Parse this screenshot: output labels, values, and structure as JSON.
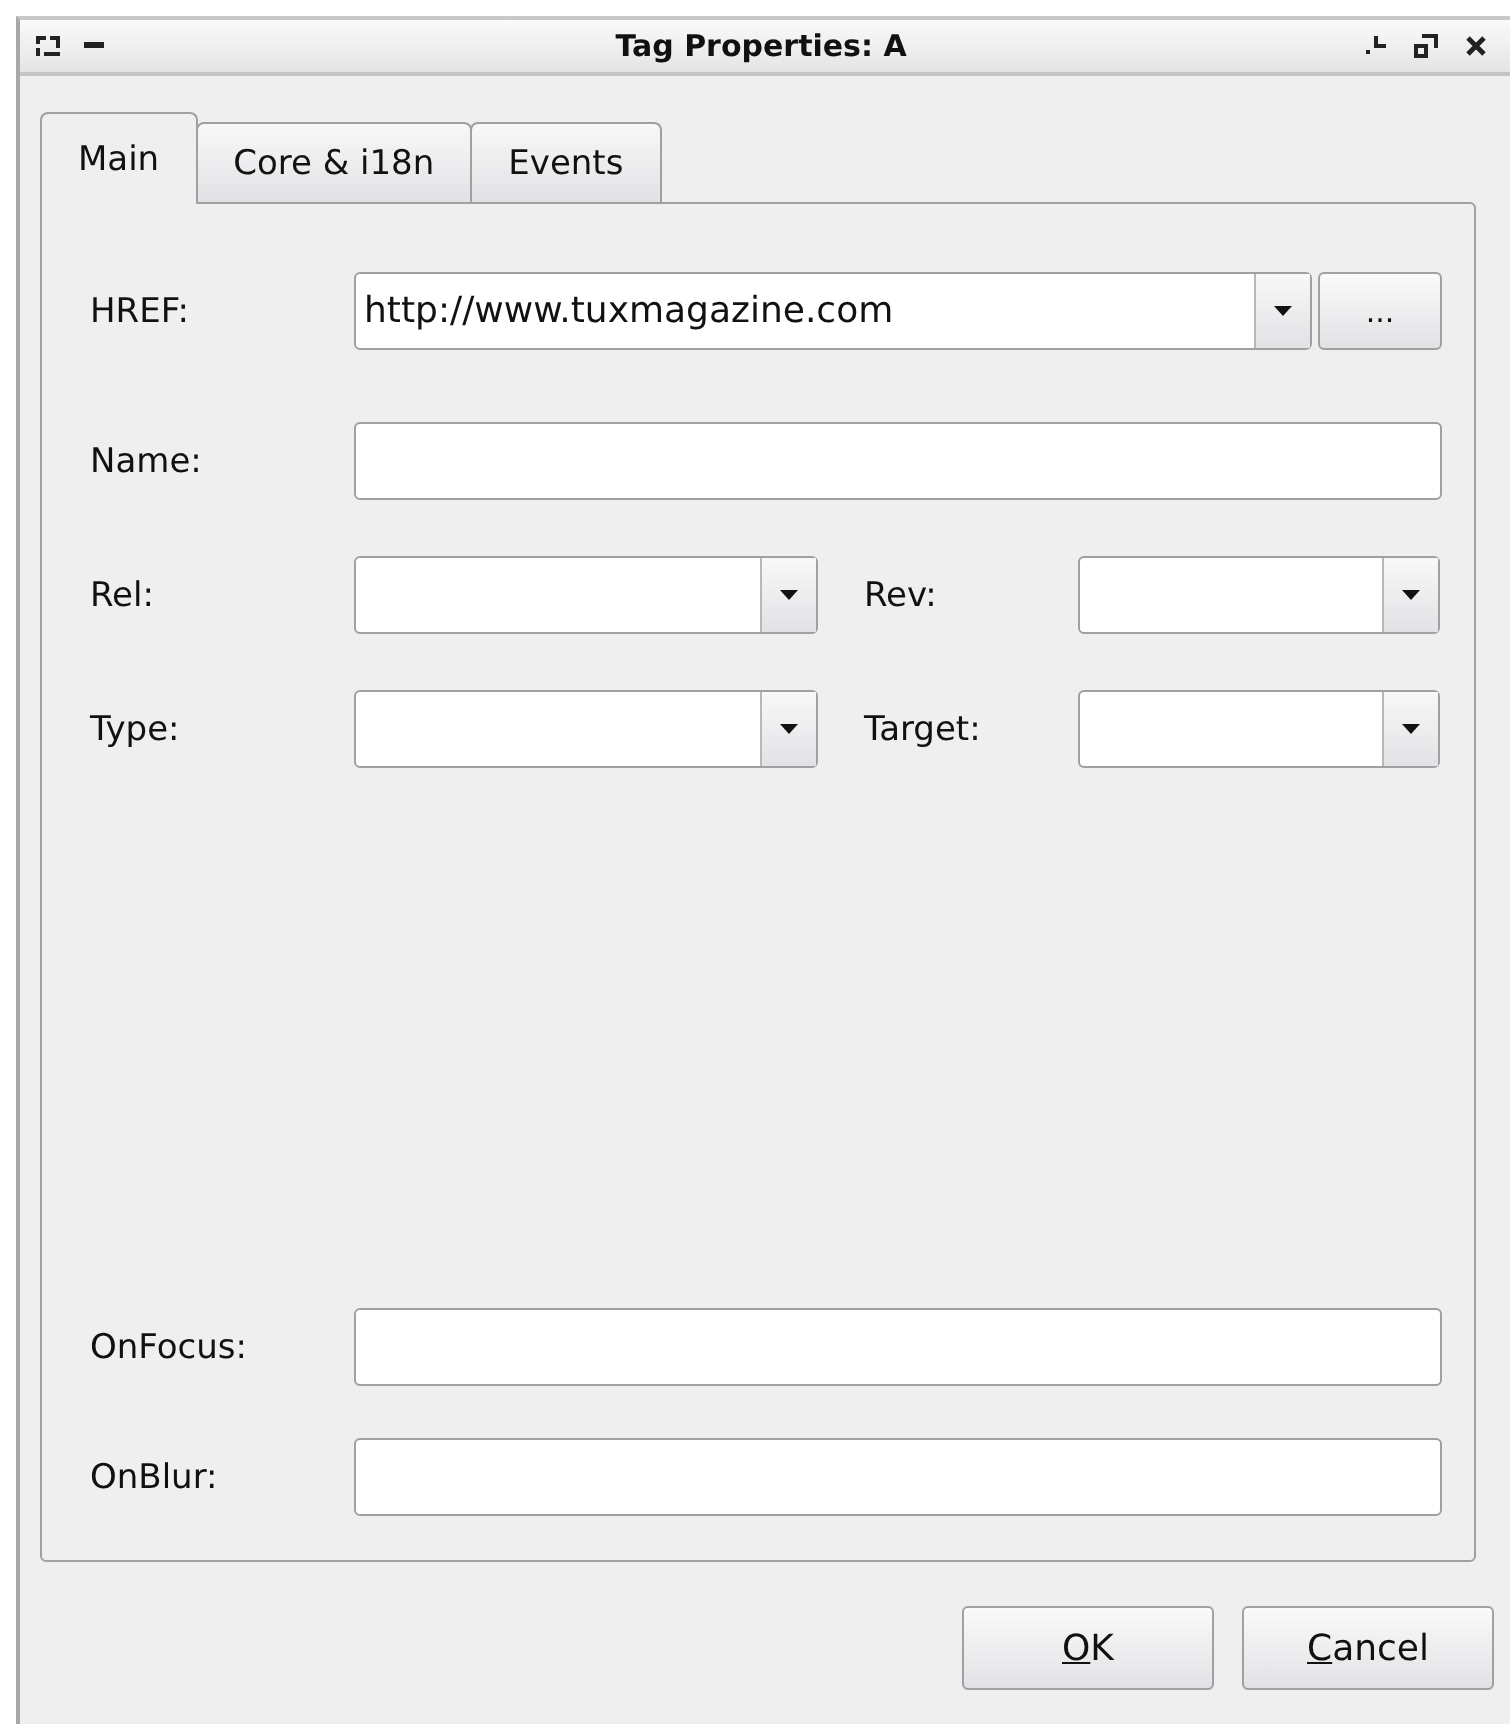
{
  "window": {
    "title": "Tag Properties: A"
  },
  "tabs": [
    {
      "label": "Main",
      "selected": true
    },
    {
      "label": "Core & i18n",
      "selected": false
    },
    {
      "label": "Events",
      "selected": false
    }
  ],
  "top_rows": [
    {
      "kind": "combo_browse",
      "label": "HREF:",
      "value": "http://www.tuxmagazine.com",
      "browse_label": "..."
    },
    {
      "kind": "text",
      "label": "Name:"
    },
    {
      "kind": "combo_pair",
      "items": [
        {
          "label": "Rel:"
        },
        {
          "label": "Rev:"
        }
      ]
    },
    {
      "kind": "combo_pair",
      "items": [
        {
          "label": "Type:"
        },
        {
          "label": "Target:"
        }
      ]
    }
  ],
  "bottom_rows": [
    {
      "kind": "text",
      "label": "OnFocus:"
    },
    {
      "kind": "text",
      "label": "OnBlur:"
    }
  ],
  "buttons": [
    {
      "label": "OK"
    },
    {
      "label": "Cancel"
    }
  ]
}
